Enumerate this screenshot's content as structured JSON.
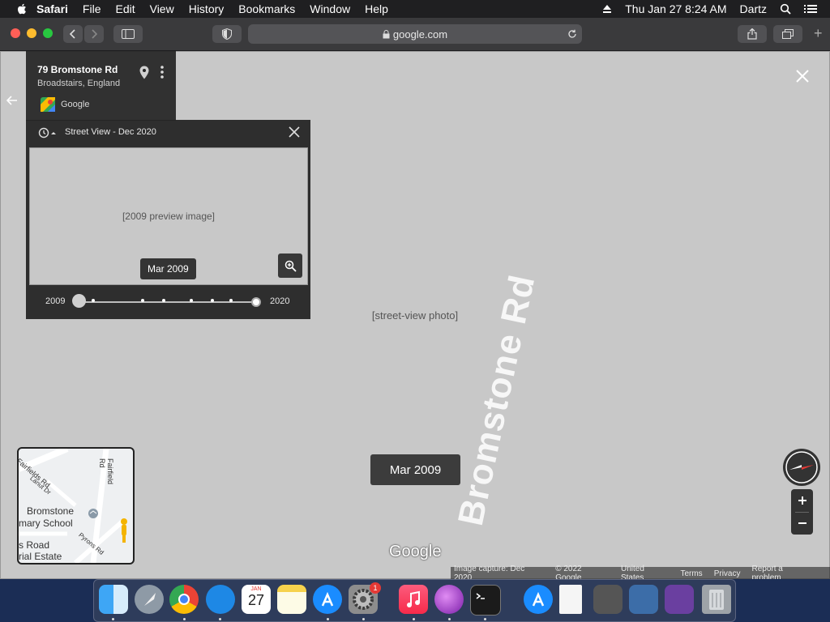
{
  "menubar": {
    "app_name": "Safari",
    "items": [
      "File",
      "Edit",
      "View",
      "History",
      "Bookmarks",
      "Window",
      "Help"
    ],
    "datetime": "Thu Jan 27  8:24 AM",
    "user": "Dartz"
  },
  "toolbar": {
    "url": "google.com",
    "new_tab": "+"
  },
  "place": {
    "title": "79 Bromstone Rd",
    "subtitle": "Broadstairs, England",
    "provider": "Google"
  },
  "time_machine": {
    "title": "Street View - Dec 2020",
    "hover_date": "Mar 2009",
    "year_start": "2009",
    "year_end": "2020",
    "selected_fraction": 0.0
  },
  "street": {
    "date_label": "Mar 2009",
    "road_name": "Bromstone Rd",
    "watermark": "Google"
  },
  "minimap": {
    "labels": [
      "Fairfields Rd",
      "Fairfield Rd",
      "Bromstone",
      "mary School",
      "s Road",
      "rial Estate",
      "Pyrons Rd",
      "Lanut Dr"
    ]
  },
  "footer": {
    "items": [
      "Image capture: Dec 2020",
      "© 2022 Google",
      "United States",
      "Terms",
      "Privacy",
      "Report a problem"
    ]
  },
  "dock": {
    "apps": [
      "Finder",
      "Launchpad",
      "Chrome",
      "Safari",
      "Calendar",
      "Notes",
      "App Store",
      "System Preferences",
      "Music",
      "Installer",
      "Terminal",
      "App Store Folder",
      "Document",
      "Screenshots",
      "Screen Sharing",
      "Photo Viewer",
      "Trash"
    ],
    "calendar_month": "JAN",
    "calendar_day": "27",
    "settings_badge": "1"
  }
}
